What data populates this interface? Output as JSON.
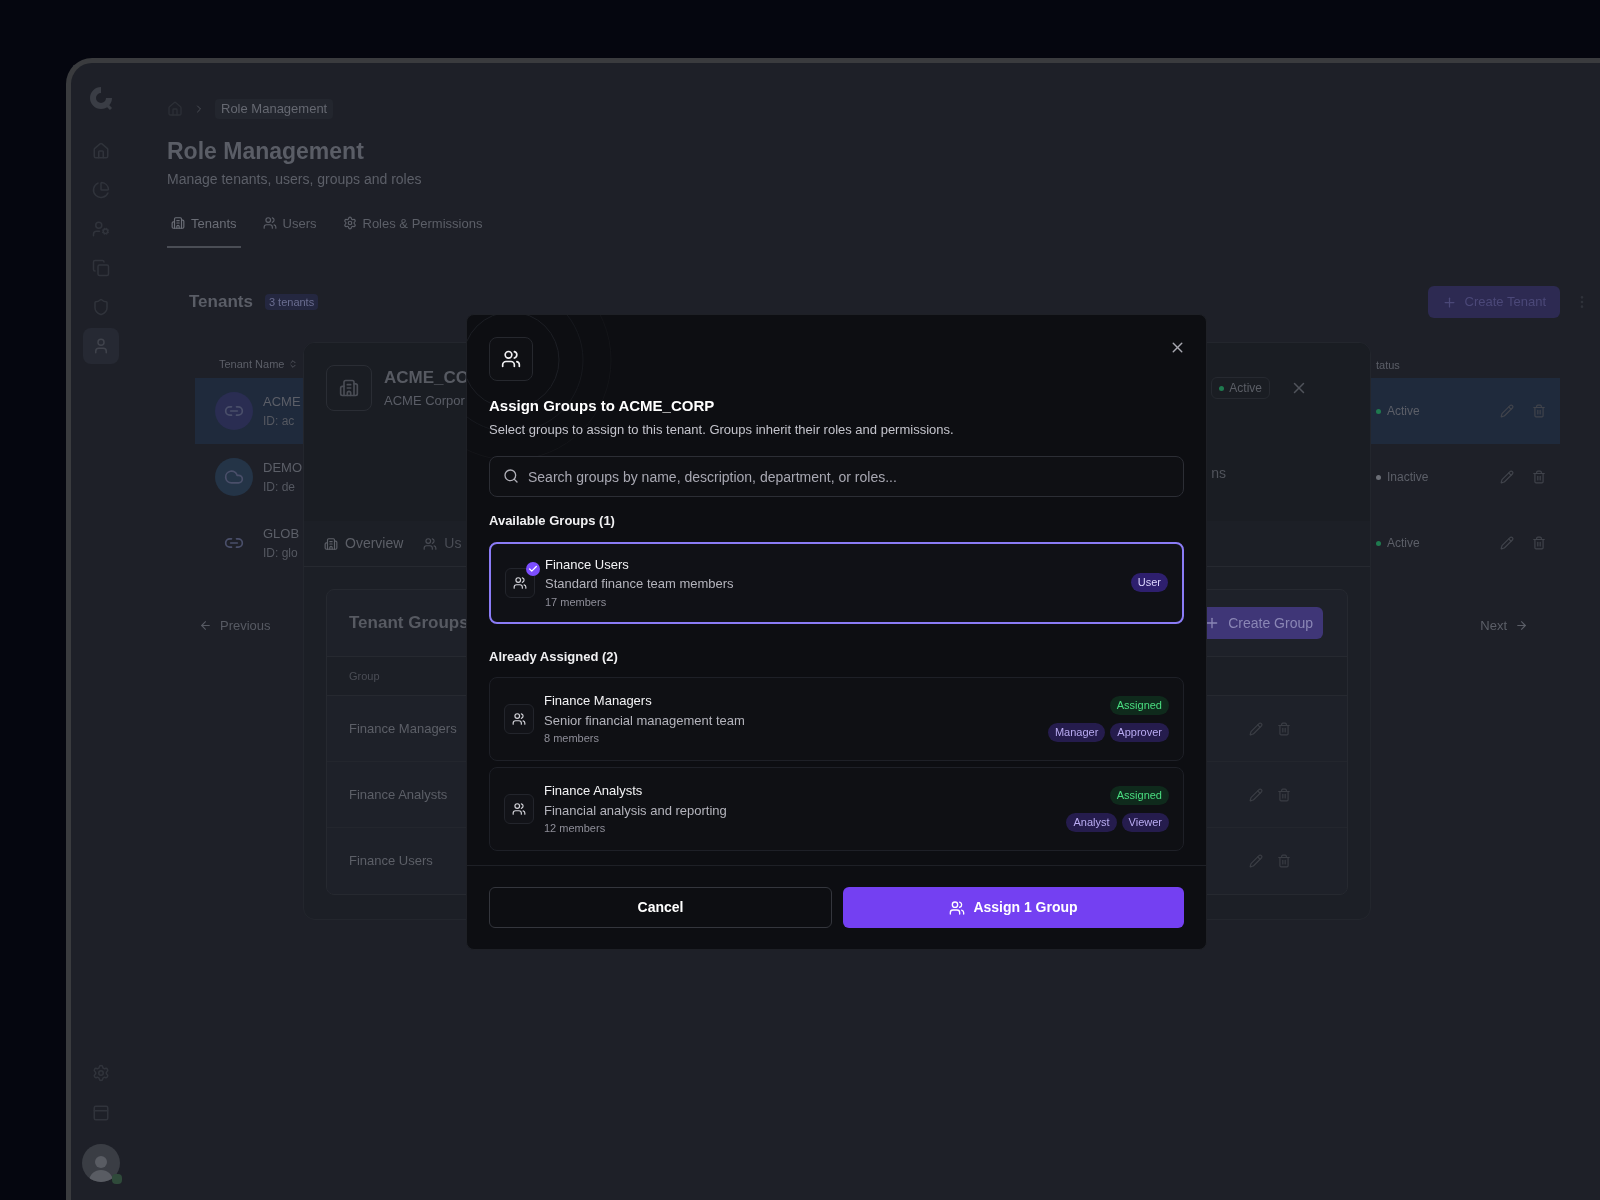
{
  "sidebar": {
    "nav": [
      {
        "selected": false
      },
      {
        "selected": false
      },
      {
        "selected": false
      },
      {
        "selected": false
      },
      {
        "selected": false
      },
      {
        "selected": true
      }
    ],
    "user": {
      "online": true
    }
  },
  "breadcrumb": {
    "current": "Role Management"
  },
  "header": {
    "title": "Role Management",
    "subtitle": "Manage tenants, users, groups and roles"
  },
  "tabs": [
    {
      "label": "Tenants",
      "selected": true
    },
    {
      "label": "Users",
      "selected": false
    },
    {
      "label": "Roles & Permissions",
      "selected": false
    }
  ],
  "tenants": {
    "title": "Tenants",
    "count": "3 tenants",
    "create_button": "Create Tenant",
    "columns": [
      "Tenant Name",
      "tatus"
    ],
    "rows": [
      {
        "kind": "link",
        "name": "ACME",
        "id": "ID: ac",
        "status": "Active",
        "active": true,
        "selected": true
      },
      {
        "kind": "cloud",
        "name": "DEMO",
        "id": "ID: de",
        "status": "Inactive",
        "active": false,
        "selected": false
      },
      {
        "kind": "chain",
        "name": "GLOB",
        "id": "ID: glo",
        "status": "Active",
        "active": true,
        "selected": false
      }
    ],
    "previous": "Previous",
    "next": "Next"
  },
  "tenant_panel": {
    "name": "ACME_CO",
    "legal_name": "ACME Corpor",
    "status": "Active",
    "active": true,
    "fragment": "ns",
    "tabs": [
      {
        "label": "Overview",
        "selected": true
      },
      {
        "label": "Us",
        "selected": false
      }
    ],
    "groups_card": {
      "title": "Tenant Groups",
      "create_button": "Create Group",
      "column": "Group",
      "rows": [
        "Finance Managers",
        "Finance Analysts",
        "Finance Users"
      ]
    }
  },
  "dialog": {
    "title": "Assign Groups to ACME_CORP",
    "subtitle": "Select groups to assign to this tenant. Groups inherit their roles and permissions.",
    "search": {
      "placeholder": "Search groups by name, description, department, or roles..."
    },
    "available_heading": "Available Groups (1)",
    "available": [
      {
        "name": "Finance Users",
        "description": "Standard finance team members",
        "members": "17 members",
        "roles": [
          "User"
        ],
        "selected": true
      }
    ],
    "assigned_heading": "Already Assigned (2)",
    "assigned": [
      {
        "name": "Finance Managers",
        "description": "Senior financial management team",
        "members": "8 members",
        "status": "Assigned",
        "roles": [
          "Manager",
          "Approver"
        ]
      },
      {
        "name": "Finance Analysts",
        "description": "Financial analysis and reporting",
        "members": "12 members",
        "status": "Assigned",
        "roles": [
          "Analyst",
          "Viewer"
        ]
      }
    ],
    "cancel": "Cancel",
    "confirm": "Assign 1 Group"
  }
}
